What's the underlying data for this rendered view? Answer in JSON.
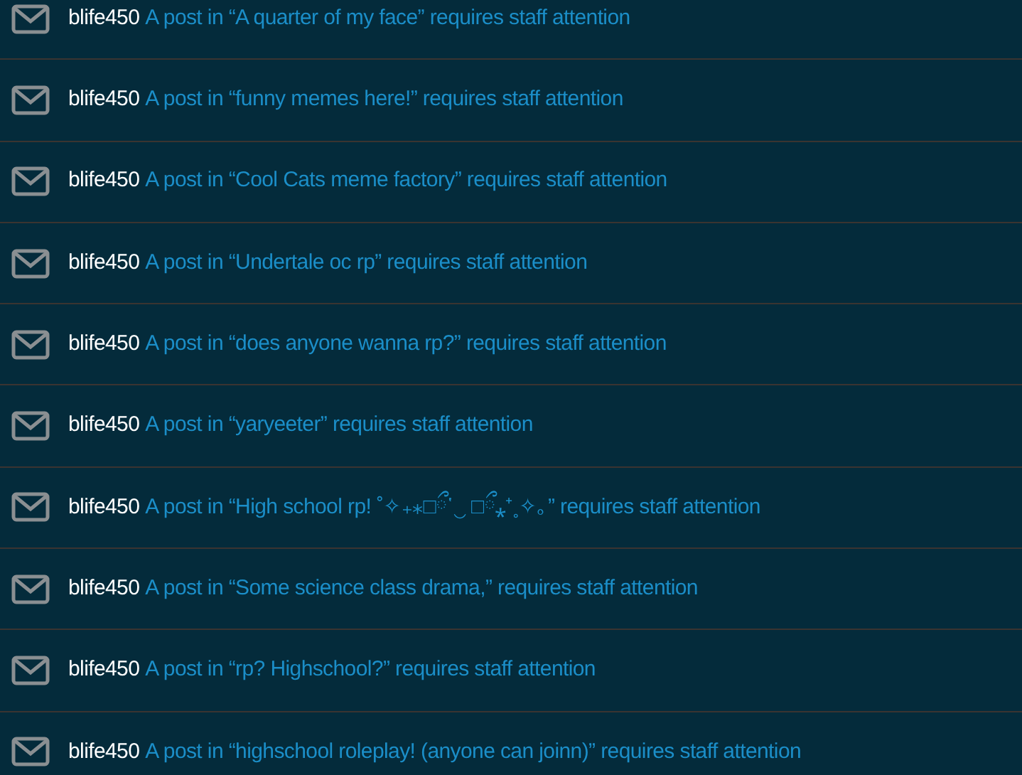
{
  "notifications": [
    {
      "user": "blife450",
      "message": "A post in “A quarter of my face” requires staff attention"
    },
    {
      "user": "blife450",
      "message": "A post in “funny memes here!” requires staff attention"
    },
    {
      "user": "blife450",
      "message": "A post in “Cool Cats meme factory” requires staff attention"
    },
    {
      "user": "blife450",
      "message": "A post in “Undertale oc rp” requires staff attention"
    },
    {
      "user": "blife450",
      "message": "A post in “does anyone wanna rp?” requires staff attention"
    },
    {
      "user": "blife450",
      "message": "A post in “yaryeeter” requires staff attention"
    },
    {
      "user": "blife450",
      "message": "A post in “High school rp! ˚✧₊⁎□ྀ῾‿ □ྀ⁎⁺˳✧｡” requires staff attention"
    },
    {
      "user": "blife450",
      "message": "A post in “Some science class drama,” requires staff attention"
    },
    {
      "user": "blife450",
      "message": "A post in “rp? Highschool?” requires staff attention"
    },
    {
      "user": "blife450",
      "message": "A post in “highschool roleplay! (anyone can joinn)” requires staff attention"
    }
  ]
}
